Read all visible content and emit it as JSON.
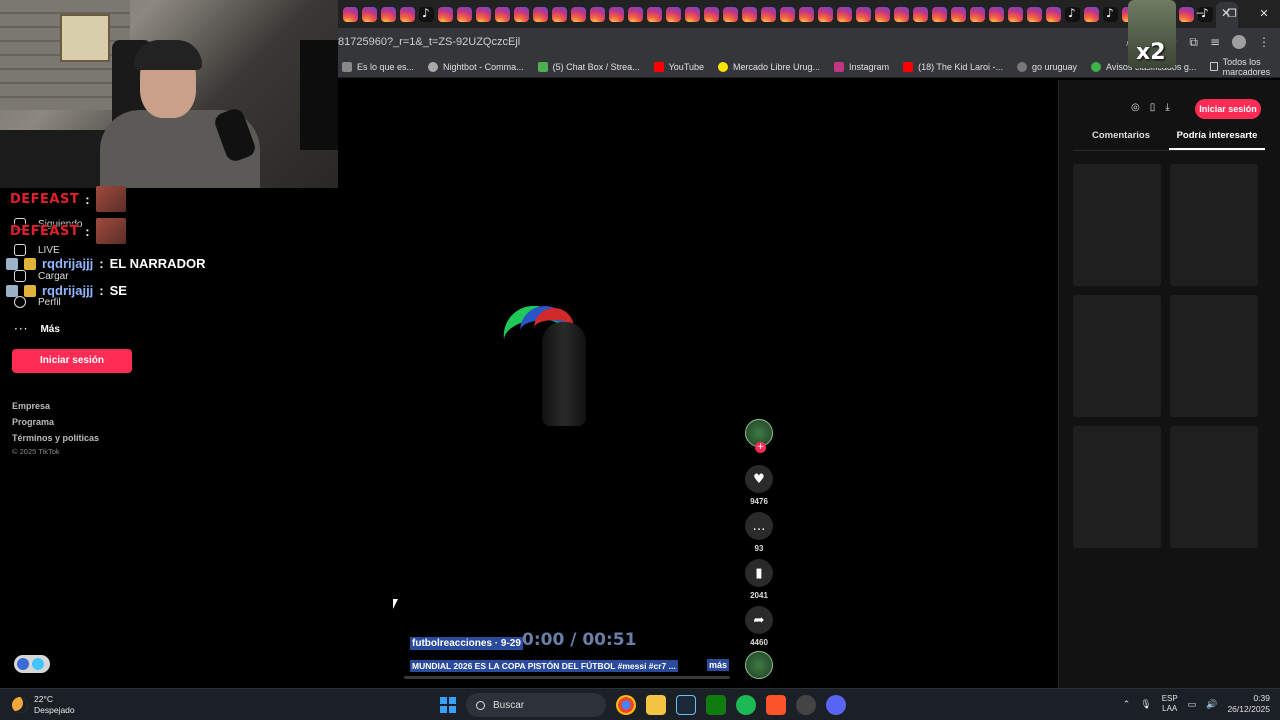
{
  "browser": {
    "url": "81725960?_r=1&_t=ZS-92UZQczcEjl",
    "bookmarks": [
      {
        "label": "Es lo que es...",
        "icon": "generic"
      },
      {
        "label": "Nightbot - Comma...",
        "icon": "nightbot"
      },
      {
        "label": "(5) Chat Box / Strea...",
        "icon": "chatbox"
      },
      {
        "label": "YouTube",
        "icon": "youtube"
      },
      {
        "label": "Mercado Libre Urug...",
        "icon": "mercadolibre"
      },
      {
        "label": "Instagram",
        "icon": "instagram"
      },
      {
        "label": "(18) The Kid Laroi -...",
        "icon": "youtube"
      },
      {
        "label": "go uruguay",
        "icon": "globe"
      },
      {
        "label": "Avisos clasificados g...",
        "icon": "ovo"
      }
    ],
    "all_bookmarks": "Todos los marcadores"
  },
  "overlay": {
    "multiplier": "x2"
  },
  "chat": {
    "lines": [
      {
        "user": "DEFEAST",
        "sep": ":",
        "message": ""
      },
      {
        "user": "DEFEAST",
        "sep": ":",
        "message": ""
      },
      {
        "user": "rqdrijajjj",
        "sep": ":",
        "message": "EL NARRADOR"
      },
      {
        "user": "rqdrijajjj",
        "sep": ":",
        "message": "SE"
      }
    ]
  },
  "sidebar": {
    "items": [
      {
        "label": "Siguiendo"
      },
      {
        "label": "LIVE"
      },
      {
        "label": "Cargar"
      },
      {
        "label": "Perfil"
      },
      {
        "label": "Más"
      }
    ],
    "login_label": "Iniciar sesión",
    "footer": [
      "Empresa",
      "Programa",
      "Términos y políticas"
    ],
    "copyright": "© 2025 TikTok"
  },
  "video": {
    "author": "futbolreacciones · 9-29",
    "time": "0:00 / 00:51",
    "description": "MUNDIAL 2026 ES LA COPA PISTÓN DEL FÚTBOL #messi #cr7 ...",
    "more": "más",
    "progress": 0.0,
    "actions": {
      "likes": "9476",
      "comments": "93",
      "saves": "2041",
      "shares": "4460"
    }
  },
  "right_panel": {
    "login_label": "Iniciar sesión",
    "tabs": [
      {
        "label": "Comentarios",
        "active": false
      },
      {
        "label": "Podría interesarte",
        "active": true
      }
    ]
  },
  "taskbar": {
    "temperature": "22°C",
    "weather": "Despejado",
    "search": "Buscar",
    "lang_1": "ESP",
    "lang_2": "LAA",
    "time": "0:39",
    "date": "26/12/2025"
  },
  "colors": {
    "accent": "#fe2c55",
    "chat_red": "#e0202c",
    "chat_blue": "#8fb6ff"
  }
}
